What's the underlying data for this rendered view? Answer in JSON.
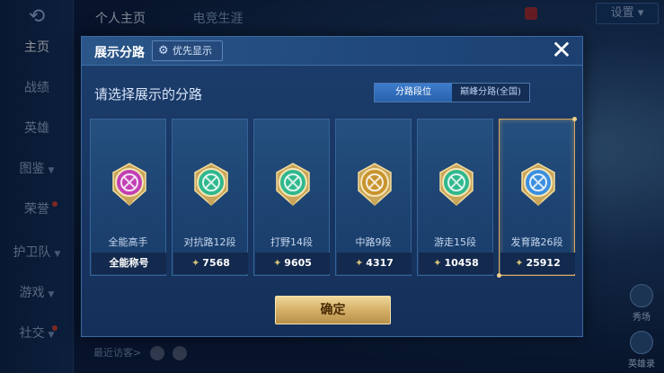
{
  "background": {
    "back_icon": "back-arrow-icon",
    "top_tabs": [
      "个人主页",
      "电竞生涯"
    ],
    "settings_label": "设置",
    "sidebar": [
      {
        "label": "主页",
        "active": true,
        "arrow": false,
        "dot": false
      },
      {
        "label": "战绩",
        "active": false,
        "arrow": false,
        "dot": false
      },
      {
        "label": "英雄",
        "active": false,
        "arrow": false,
        "dot": false
      },
      {
        "label": "图鉴",
        "active": false,
        "arrow": true,
        "dot": false
      },
      {
        "label": "荣誉",
        "active": false,
        "arrow": false,
        "dot": true
      },
      {
        "label": "护卫队",
        "active": false,
        "arrow": true,
        "dot": false
      },
      {
        "label": "游戏",
        "active": false,
        "arrow": true,
        "dot": false
      },
      {
        "label": "社交",
        "active": false,
        "arrow": true,
        "dot": true
      }
    ],
    "recent_visits_label": "最近访客>",
    "right_buttons": [
      "秀场",
      "英雄录"
    ]
  },
  "modal": {
    "title": "展示分路",
    "priority_button_label": "优先显示",
    "subtitle": "请选择展示的分路",
    "toggle": [
      {
        "label": "分路段位",
        "active": true
      },
      {
        "label": "巅峰分路(全国)",
        "active": false
      }
    ],
    "cards": [
      {
        "label": "全能高手",
        "stat": "全能称号",
        "has_leaf": false,
        "selected": false,
        "emblem_color": "#c23fb5",
        "icon": "all-round-emblem-icon"
      },
      {
        "label": "对抗路12段",
        "stat": "7568",
        "has_leaf": true,
        "selected": false,
        "emblem_color": "#2fb88e",
        "icon": "clash-lane-emblem-icon"
      },
      {
        "label": "打野14段",
        "stat": "9605",
        "has_leaf": true,
        "selected": false,
        "emblem_color": "#2fb88e",
        "icon": "jungle-emblem-icon"
      },
      {
        "label": "中路9段",
        "stat": "4317",
        "has_leaf": true,
        "selected": false,
        "emblem_color": "#c9932d",
        "icon": "mid-lane-emblem-icon"
      },
      {
        "label": "游走15段",
        "stat": "10458",
        "has_leaf": true,
        "selected": false,
        "emblem_color": "#2fb88e",
        "icon": "roam-emblem-icon"
      },
      {
        "label": "发育路26段",
        "stat": "25912",
        "has_leaf": true,
        "selected": true,
        "emblem_color": "#3a8fe0",
        "icon": "farm-lane-emblem-icon"
      }
    ],
    "confirm_label": "确定"
  }
}
